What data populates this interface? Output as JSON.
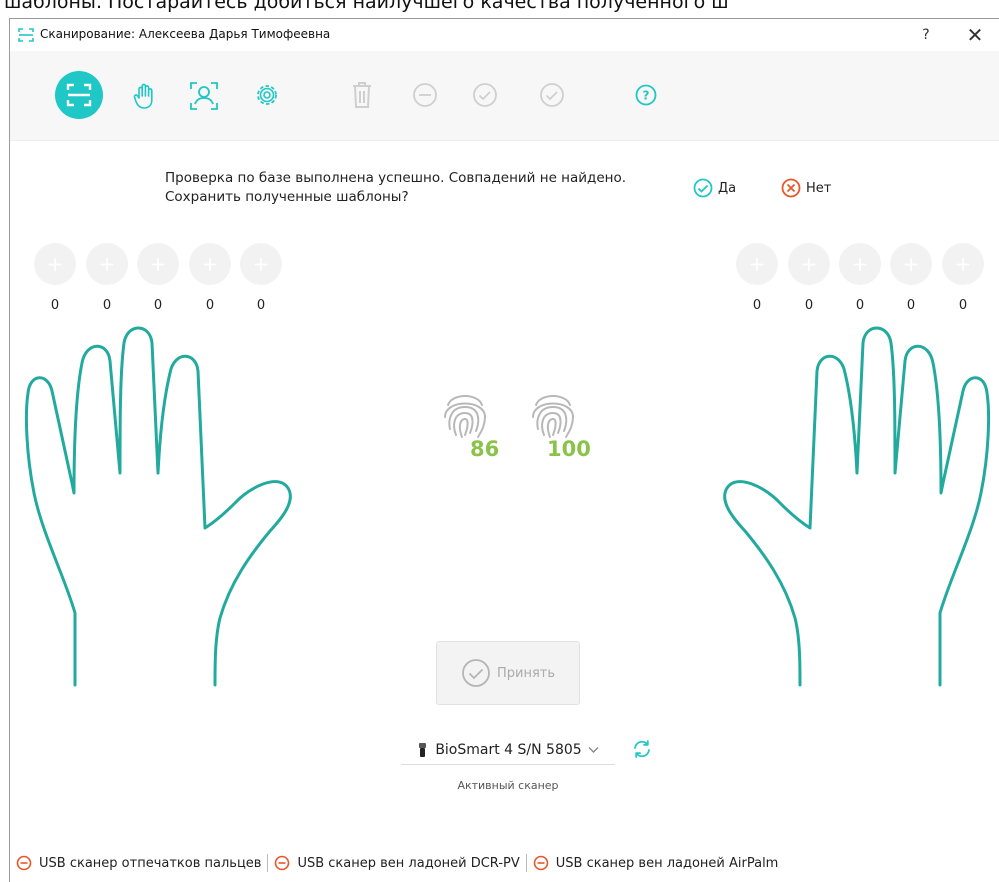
{
  "page_top_text": "шаблоны. Постарайтесь добиться наилучшего качества полученного ш",
  "window": {
    "title": "Сканирование: Алексеева Дарья Тимофеевна",
    "help_label": "?",
    "close_label": "✕"
  },
  "toolbar": {
    "icons": [
      "scan-icon",
      "hand-icon",
      "face-scan-icon",
      "settings-icon",
      "trash-icon",
      "minus-circle-icon",
      "check-circle-icon",
      "check-circle-icon",
      "help-circle-icon"
    ]
  },
  "prompt": {
    "line1": "Проверка по базе выполнена успешно. Совпадений не найдено.",
    "line2": "Сохранить полученные шаблоны?",
    "yes_label": "Да",
    "no_label": "Нет"
  },
  "left_hand": {
    "counts": [
      "0",
      "0",
      "0",
      "0",
      "0"
    ]
  },
  "right_hand": {
    "counts": [
      "0",
      "0",
      "0",
      "0",
      "0"
    ]
  },
  "fingerprints": {
    "score1": "86",
    "score2": "100"
  },
  "accept_label": "Принять",
  "scanner": {
    "selected": "BioSmart 4 S/N 5805",
    "caption": "Активный сканер"
  },
  "status": [
    "USB сканер отпечатков пальцев",
    "USB сканер вен ладоней DCR-PV",
    "USB сканер вен ладоней AirPalm"
  ],
  "colors": {
    "accent": "#1fc7c6",
    "hand_outline": "#22aa9e",
    "score": "#8bc34a",
    "danger": "#e8562a",
    "disabled": "#cfcfcf"
  }
}
